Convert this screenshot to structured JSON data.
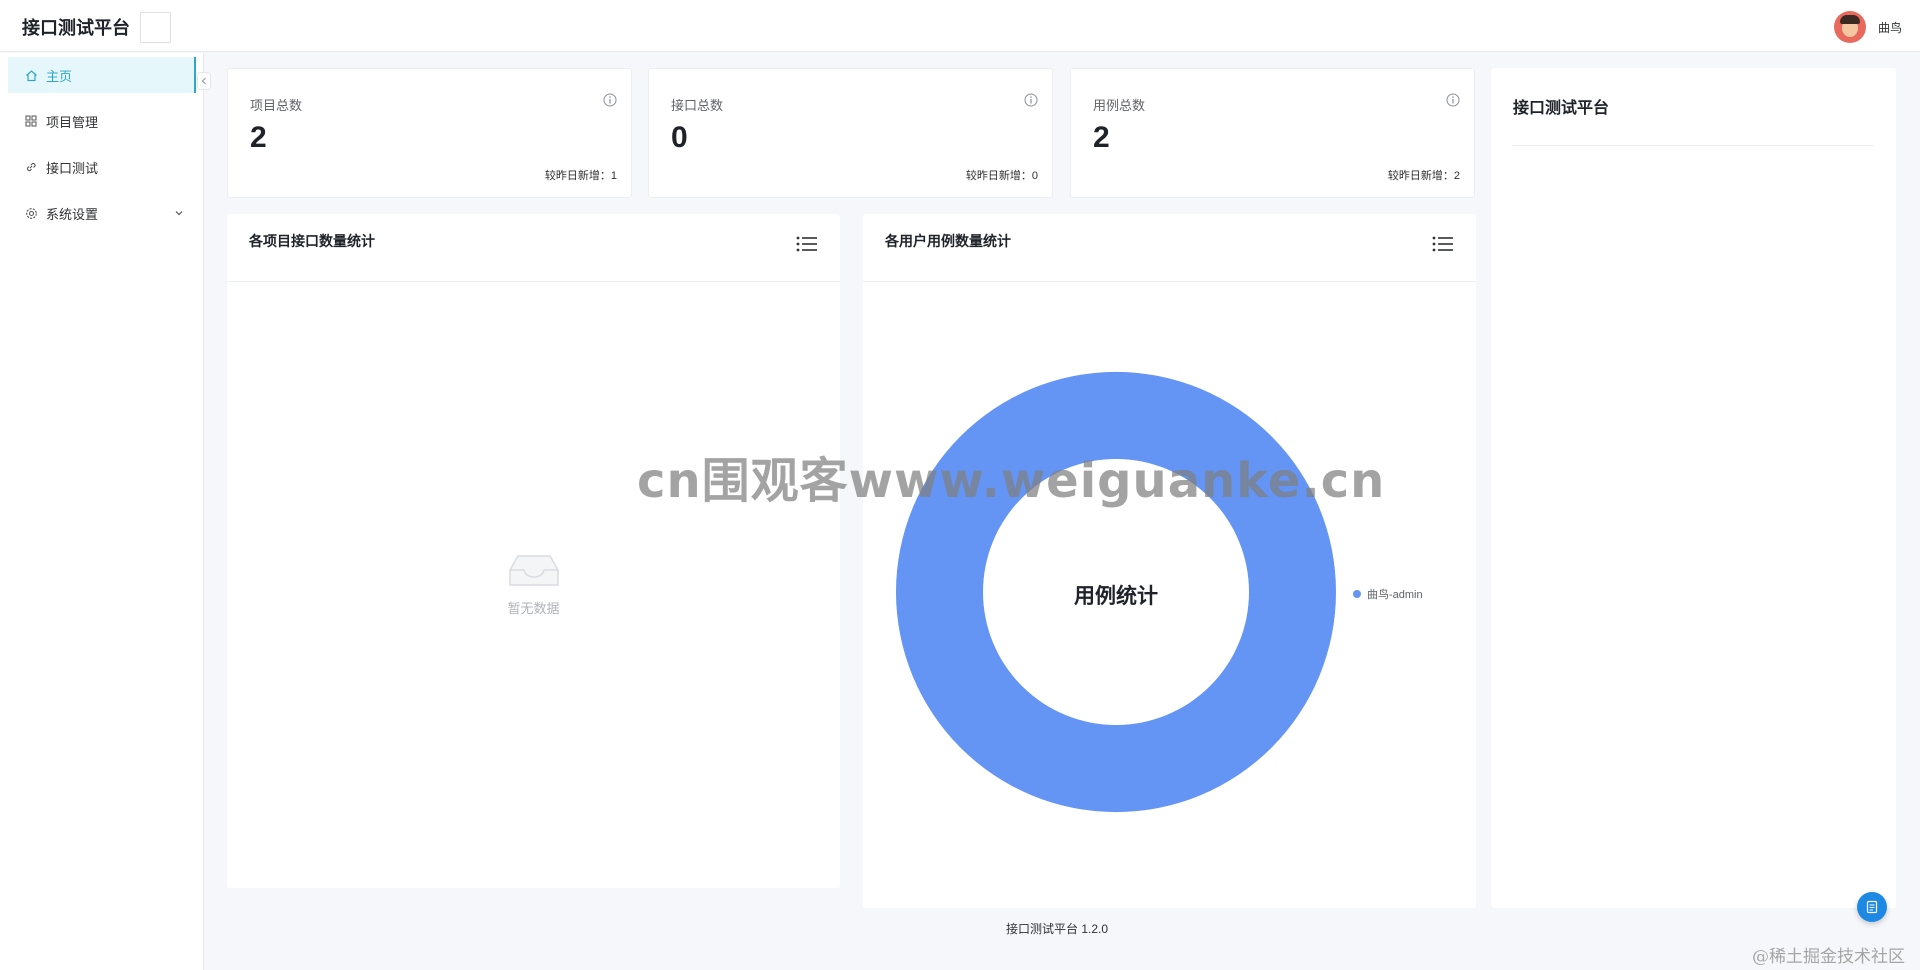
{
  "header": {
    "title": "接口测试平台",
    "user_name": "曲鸟"
  },
  "sidebar": {
    "items": [
      {
        "label": "主页",
        "icon": "home-icon",
        "active": true
      },
      {
        "label": "项目管理",
        "icon": "grid-icon",
        "active": false
      },
      {
        "label": "接口测试",
        "icon": "link-icon",
        "active": false
      },
      {
        "label": "系统设置",
        "icon": "gear-icon",
        "active": false,
        "expandable": true
      }
    ]
  },
  "stats": [
    {
      "title": "项目总数",
      "value": "2",
      "sub": "较昨日新增：1"
    },
    {
      "title": "接口总数",
      "value": "0",
      "sub": "较昨日新增：0"
    },
    {
      "title": "用例总数",
      "value": "2",
      "sub": "较昨日新增：2"
    }
  ],
  "panels": {
    "project_api": {
      "title": "各项目接口数量统计",
      "empty_text": "暂无数据"
    },
    "user_case": {
      "title": "各用户用例数量统计"
    }
  },
  "chart_data": {
    "type": "pie",
    "title": "用例统计",
    "series": [
      {
        "name": "曲鸟-admin",
        "values": [
          2
        ]
      }
    ],
    "legend_position": "right",
    "colors": [
      "#6495f4"
    ]
  },
  "right_panel": {
    "title": "接口测试平台"
  },
  "footer": {
    "text": "接口测试平台 1.2.0"
  },
  "overlays": {
    "watermark": "cn围观客www.weiguanke.cn",
    "corner": "@稀土掘金技术社区"
  },
  "colors": {
    "accent": "#2aa7c9",
    "donut": "#6495f4",
    "float_button": "#1e88e5"
  }
}
